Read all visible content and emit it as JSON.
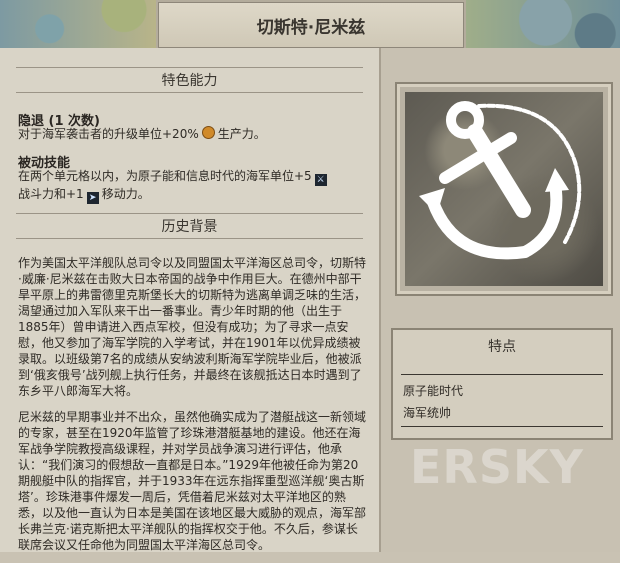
{
  "title": "切斯特·尼米兹",
  "unique_ability": {
    "header": "特色能力",
    "ability1": {
      "name": "隐退 (1 次数)",
      "desc_a": "对于海军袭击者的升级单位+20%",
      "icon": "production-icon",
      "desc_b": "生产力。"
    },
    "ability2": {
      "name": "被动技能",
      "line1": "在两个单元格以内，为原子能和信息时代的海军单位+5",
      "icon1": "combat-strength-icon",
      "line2a": "战斗力和+1",
      "icon2": "movement-icon",
      "line2b": "移动力。"
    }
  },
  "history": {
    "header": "历史背景",
    "p1": "作为美国太平洋舰队总司令以及同盟国太平洋海区总司令，切斯特·威廉·尼米兹在击败大日本帝国的战争中作用巨大。在德州中部干旱平原上的弗雷德里克斯堡长大的切斯特为逃离单调乏味的生活，渴望通过加入军队来干出一番事业。青少年时期的他（出生于1885年）曾申请进入西点军校，但没有成功；为了寻求一点安慰，他又参加了海军学院的入学考试，并在1901年以优异成绩被录取。以班级第7名的成绩从安纳波利斯海军学院毕业后，他被派到‘俄亥俄号’战列舰上执行任务，并最终在该舰抵达日本时遇到了东乡平八郎海军大将。",
    "p2": "尼米兹的早期事业并不出众，虽然他确实成为了潜艇战这一新领域的专家，甚至在1920年监管了珍珠港潜艇基地的建设。他还在海军战争学院教授高级课程，并对学员战争演习进行评估，他承认：“我们演习的假想敌一直都是日本。”1929年他被任命为第20期舰艇中队的指挥官，并于1933年在远东指挥重型巡洋舰‘奥古斯塔’。珍珠港事件爆发一周后，凭借着尼米兹对太平洋地区的熟悉，以及他一直认为日本是美国在该地区最大威胁的观点，海军部长弗兰克·诺克斯把太平洋舰队的指挥权交于他。不久后，参谋长联席会议又任命他为同盟国太平洋海区总司令。"
  },
  "portrait": {
    "icon": "anchor-icon"
  },
  "traits": {
    "header": "特点",
    "items": [
      "原子能时代",
      "海军统帅"
    ]
  },
  "watermark": "ERSKY",
  "colors": {
    "panel": "#d9d4c7",
    "frame": "#8b8475",
    "text": "#2f2b26"
  }
}
